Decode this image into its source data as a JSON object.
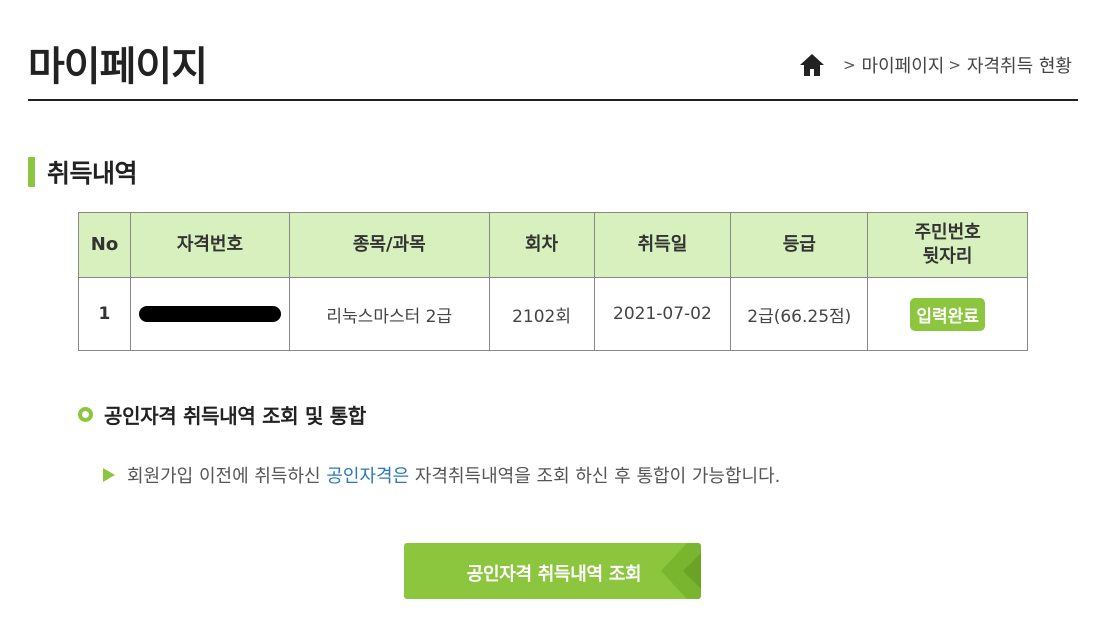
{
  "header": {
    "title": "마이페이지",
    "breadcrumb": {
      "separator": ">",
      "items": [
        "마이페이지",
        "자격취득 현황"
      ]
    }
  },
  "section": {
    "title": "취득내역"
  },
  "table": {
    "headers": {
      "no": "No",
      "cert_no": "자격번호",
      "subject": "종목/과목",
      "round": "회차",
      "date": "취득일",
      "grade": "등급",
      "id_line1": "주민번호",
      "id_line2": "뒷자리"
    },
    "rows": [
      {
        "no": "1",
        "subject": "리눅스마스터 2급",
        "round": "2102회",
        "date": "2021-07-02",
        "grade": "2급(66.25점)",
        "status": "입력완료"
      }
    ]
  },
  "integration": {
    "title": "공인자격 취득내역 조회 및 통합",
    "info_before": "회원가입 이전에 취득하신 ",
    "info_highlight": "공인자격은",
    "info_after": " 자격취득내역을 조회 하신 후 통합이 가능합니다.",
    "button_label": "공인자격 취득내역 조회"
  },
  "colors": {
    "accent": "#8cc63f",
    "table_header_bg": "#d7f0bd",
    "link": "#2a78b8"
  }
}
